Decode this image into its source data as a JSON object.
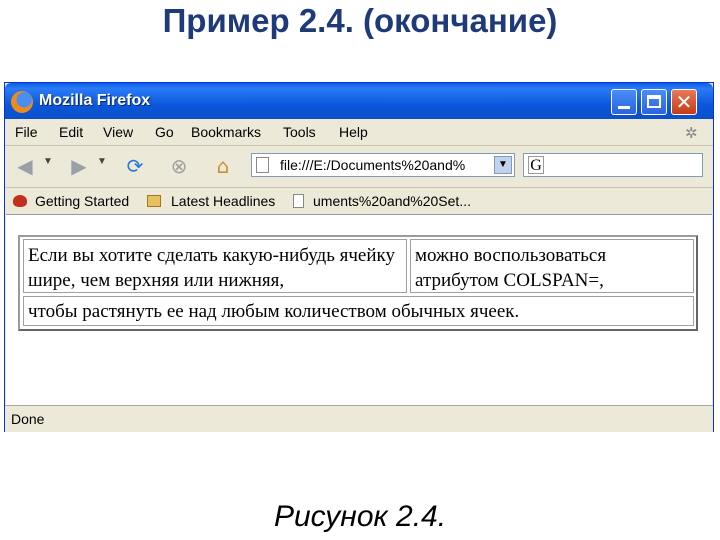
{
  "slide": {
    "title": "Пример 2.4. (окончание)",
    "caption": "Рисунок 2.4."
  },
  "window": {
    "title": "Mozilla Firefox"
  },
  "menu": [
    {
      "label": "File"
    },
    {
      "label": "Edit"
    },
    {
      "label": "View"
    },
    {
      "label": "Go"
    },
    {
      "label": "Bookmarks"
    },
    {
      "label": "Tools"
    },
    {
      "label": "Help"
    }
  ],
  "navigation": {
    "url": "file:///E:/Documents%20and%",
    "search_engine_icon": "G"
  },
  "bookmarks": [
    {
      "label": "Getting Started",
      "icon": "firefox-bookmark-icon"
    },
    {
      "label": "Latest Headlines",
      "icon": "folder-icon"
    },
    {
      "label": "uments%20and%20Set...",
      "icon": "page-icon"
    }
  ],
  "page_table": {
    "row1_cell1": "Если вы хотите сделать какую-нибудь ячейку шире, чем верхняя или нижняя,",
    "row1_cell2": "можно воспользоваться атрибутом COLSPAN=,",
    "row2_cell1": "чтобы растянуть ее над любым количеством обычных ячеек."
  },
  "status": {
    "text": "Done"
  },
  "colors": {
    "titlebar": "#0a5ce8",
    "chrome": "#ece9d8",
    "slide_title": "#1f3a7a"
  }
}
